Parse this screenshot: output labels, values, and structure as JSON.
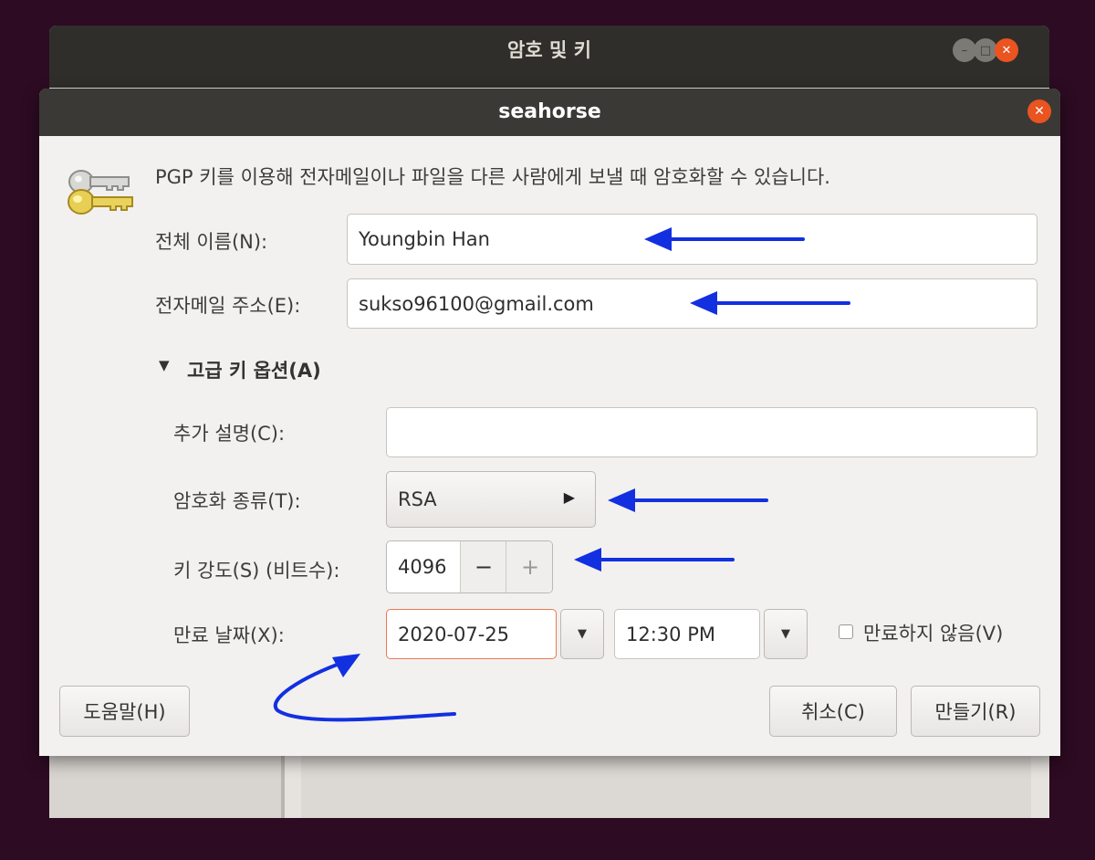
{
  "bg_window": {
    "title": "암호 및 키"
  },
  "dialog": {
    "title": "seahorse",
    "description": "PGP 키를 이용해 전자메일이나 파일을 다른 사람에게 보낼 때 암호화할 수 있습니다.",
    "fullname_label": "전체 이름(N):",
    "fullname_value": "Youngbin Han",
    "email_label": "전자메일 주소(E):",
    "email_value": "sukso96100@gmail.com",
    "advanced_label": "고급 키 옵션(A)",
    "comment_label": "추가 설명(C):",
    "comment_value": "",
    "enc_type_label": "암호화 종류(T):",
    "enc_type_value": "RSA",
    "key_strength_label": "키 강도(S) (비트수):",
    "key_strength_value": "4096",
    "expiry_label": "만료 날짜(X):",
    "expiry_date": "2020-07-25",
    "expiry_time": "12:30 PM",
    "never_expire_label": "만료하지 않음(V)",
    "never_expire_checked": false,
    "help_label": "도움말(H)",
    "cancel_label": "취소(C)",
    "create_label": "만들기(R)"
  },
  "colors": {
    "accent_orange": "#e95420",
    "annotation_blue": "#1230e0"
  }
}
